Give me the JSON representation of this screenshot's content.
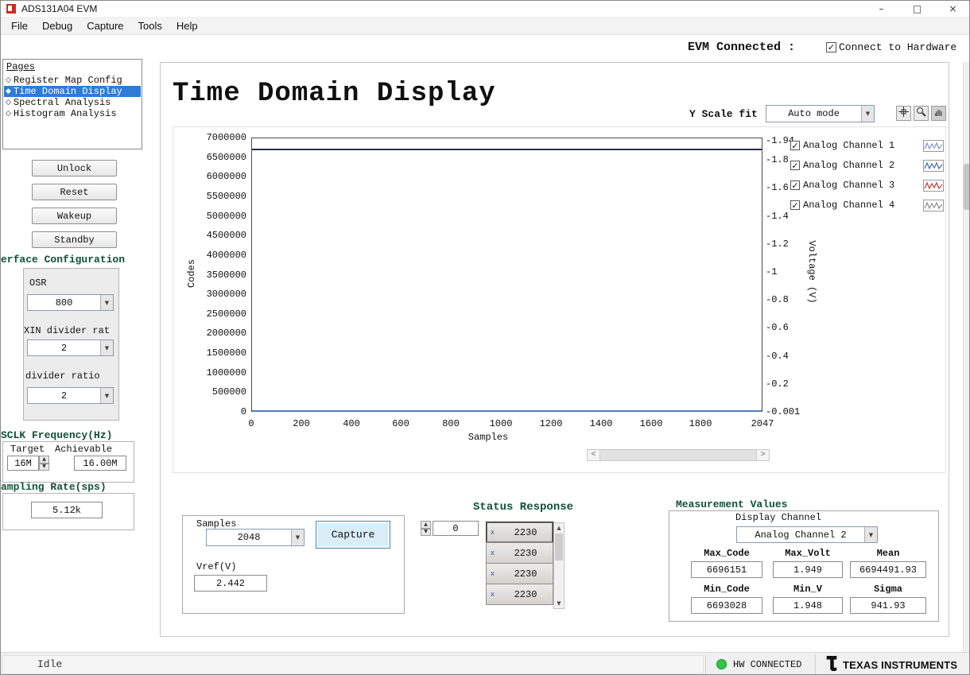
{
  "window": {
    "title": "ADS131A04 EVM"
  },
  "icons": {
    "minimize": "–",
    "maximize": "□",
    "close": "×",
    "dropdown_arrow": "▼",
    "spin_up": "▲",
    "spin_down": "▼",
    "scroll_left": "<",
    "scroll_right": ">",
    "scroll_up": "▲",
    "scroll_down": "▼",
    "check": "✓",
    "diamond_empty": "◇",
    "diamond_filled": "◆"
  },
  "menu": {
    "items": [
      "File",
      "Debug",
      "Capture",
      "Tools",
      "Help"
    ]
  },
  "header": {
    "evm_label": "EVM Connected :",
    "connect_label": "Connect to Hardware",
    "connect_checked": true
  },
  "pages": {
    "title": "Pages",
    "items": [
      {
        "label": "Register Map Config",
        "selected": false
      },
      {
        "label": "Time Domain Display",
        "selected": true
      },
      {
        "label": "Spectral Analysis",
        "selected": false
      },
      {
        "label": "Histogram Analysis",
        "selected": false
      }
    ]
  },
  "sidebar": {
    "buttons": [
      "Unlock",
      "Reset",
      "Wakeup",
      "Standby"
    ],
    "interface": {
      "heading": "erface Configuration",
      "osr_label": "OSR",
      "osr_value": "800",
      "clkin_label": "XIN divider rat",
      "clkin_value": "2",
      "iclk_label": "divider ratio",
      "iclk_value": "2"
    },
    "sclk": {
      "heading": "SCLK Frequency(Hz)",
      "target_label": "Target",
      "achievable_label": "Achievable",
      "target_value": "16M",
      "achievable_value": "16.00M"
    },
    "sampling": {
      "heading": "ampling Rate(sps)",
      "value": "5.12k"
    }
  },
  "main": {
    "title": "Time Domain Display",
    "yscale_label": "Y Scale fit",
    "yscale_value": "Auto mode"
  },
  "chart_data": {
    "type": "line",
    "title": "Time Domain Display",
    "xlabel": "Samples",
    "ylabel_left": "Codes",
    "ylabel_right": "Voltage (V)",
    "grid": false,
    "legend_position": "right",
    "x_range": [
      0,
      2047
    ],
    "x_ticks": [
      0,
      200,
      400,
      600,
      800,
      1000,
      1200,
      1400,
      1600,
      1800,
      2047
    ],
    "y_left_range": [
      0,
      7000000
    ],
    "y_left_ticks": [
      7000000,
      6500000,
      6000000,
      5500000,
      5000000,
      4500000,
      4000000,
      3500000,
      3000000,
      2500000,
      2000000,
      1500000,
      1000000,
      500000,
      0
    ],
    "y_right_range": [
      0,
      1.96
    ],
    "y_right_ticks": [
      {
        "label": "-1.94",
        "value": 1.94
      },
      {
        "label": "-1.8",
        "value": 1.8
      },
      {
        "label": "-1.6",
        "value": 1.6
      },
      {
        "label": "-1.4",
        "value": 1.4
      },
      {
        "label": "-1.2",
        "value": 1.2
      },
      {
        "label": "-1",
        "value": 1.0
      },
      {
        "label": "-0.8",
        "value": 0.8
      },
      {
        "label": "-0.6",
        "value": 0.6
      },
      {
        "label": "-0.4",
        "value": 0.4
      },
      {
        "label": "-0.2",
        "value": 0.2
      },
      {
        "label": "-0.001",
        "value": 0.001
      }
    ],
    "series": [
      {
        "id": "signal-mean",
        "color": "#25304d",
        "flat_value": 6694491
      },
      {
        "id": "baseline",
        "color": "#4e7fb8",
        "flat_value": 15000
      }
    ],
    "legend": [
      {
        "label": "Analog Channel 1",
        "color": "#7b93d6",
        "checked": true
      },
      {
        "label": "Analog Channel 2",
        "color": "#3c64c8",
        "checked": true
      },
      {
        "label": "Analog Channel 3",
        "color": "#c03a30",
        "checked": true
      },
      {
        "label": "Analog Channel 4",
        "color": "#8c8c8c",
        "checked": true
      }
    ]
  },
  "capture_panel": {
    "samples_label": "Samples",
    "samples_value": "2048",
    "capture_button": "Capture",
    "vref_label": "Vref(V)",
    "vref_value": "2.442"
  },
  "status_response": {
    "heading": "Status Response",
    "spinner_value": "0",
    "row_prefix": "x",
    "rows": [
      "2230",
      "2230",
      "2230",
      "2230"
    ]
  },
  "measurement": {
    "heading": "Measurement Values",
    "display_channel_label": "Display Channel",
    "display_channel_value": "Analog Channel 2",
    "fields": [
      {
        "label": "Max_Code",
        "value": "6696151"
      },
      {
        "label": "Max_Volt",
        "value": "1.949"
      },
      {
        "label": "Mean",
        "value": "6694491.93"
      },
      {
        "label": "Min_Code",
        "value": "6693028"
      },
      {
        "label": "Min_V",
        "value": "1.948"
      },
      {
        "label": "Sigma",
        "value": "941.93"
      }
    ]
  },
  "statusbar": {
    "state": "Idle",
    "hw_status": "HW CONNECTED",
    "brand": "TEXAS INSTRUMENTS"
  },
  "colors": {
    "selection_blue": "#2e7cd6",
    "heading_green": "#0f5135",
    "capture_bg": "#daeef8",
    "led_green": "#29c940",
    "series_dark": "#25304d",
    "series_blue": "#4e7fb8"
  }
}
